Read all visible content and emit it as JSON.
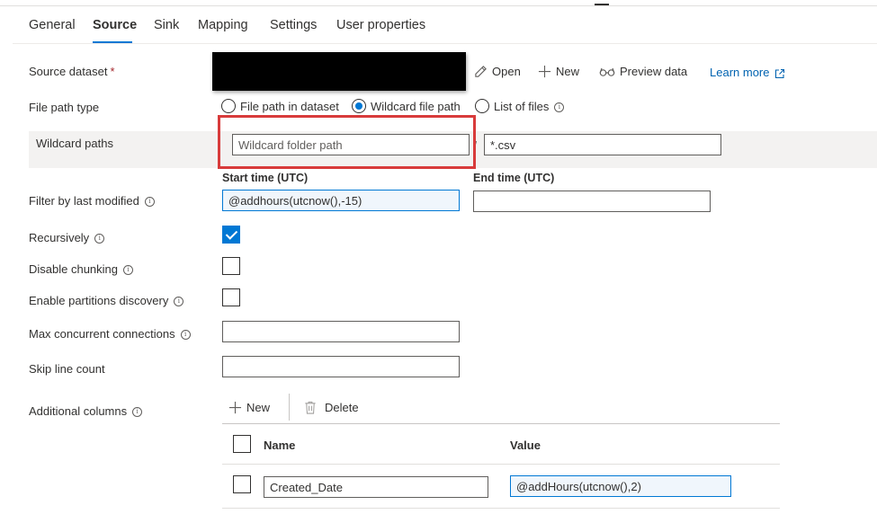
{
  "tabs": [
    {
      "label": "General"
    },
    {
      "label": "Source",
      "active": true
    },
    {
      "label": "Sink"
    },
    {
      "label": "Mapping"
    },
    {
      "label": "Settings"
    },
    {
      "label": "User properties"
    }
  ],
  "source_dataset": {
    "label": "Source dataset",
    "required_mark": "*",
    "actions": {
      "open": "Open",
      "new": "New",
      "preview": "Preview data",
      "learn_more": "Learn more"
    }
  },
  "file_path_type": {
    "label": "File path type",
    "options": [
      {
        "label": "File path in dataset",
        "selected": false
      },
      {
        "label": "Wildcard file path",
        "selected": true
      },
      {
        "label": "List of files",
        "selected": false
      }
    ]
  },
  "wildcard_paths": {
    "label": "Wildcard paths",
    "folder_placeholder": "Wildcard folder path",
    "folder_value": "",
    "file_value": "*.csv"
  },
  "filter_last_modified": {
    "label": "Filter by last modified",
    "start_label": "Start time (UTC)",
    "start_value": "@addhours(utcnow(),-15)",
    "end_label": "End time (UTC)",
    "end_value": ""
  },
  "recursively": {
    "label": "Recursively",
    "checked": true
  },
  "disable_chunking": {
    "label": "Disable chunking",
    "checked": false
  },
  "enable_partitions_discovery": {
    "label": "Enable partitions discovery",
    "checked": false
  },
  "max_concurrent_connections": {
    "label": "Max concurrent connections",
    "value": ""
  },
  "skip_line_count": {
    "label": "Skip line count",
    "value": ""
  },
  "additional_columns": {
    "label": "Additional columns",
    "new_label": "New",
    "delete_label": "Delete",
    "headers": {
      "name": "Name",
      "value": "Value"
    },
    "rows": [
      {
        "name": "Created_Date",
        "value": "@addHours(utcnow(),2)"
      }
    ]
  },
  "colors": {
    "accent": "#0078d4",
    "highlight_box": "#d83b3b",
    "required": "#a4262c"
  }
}
